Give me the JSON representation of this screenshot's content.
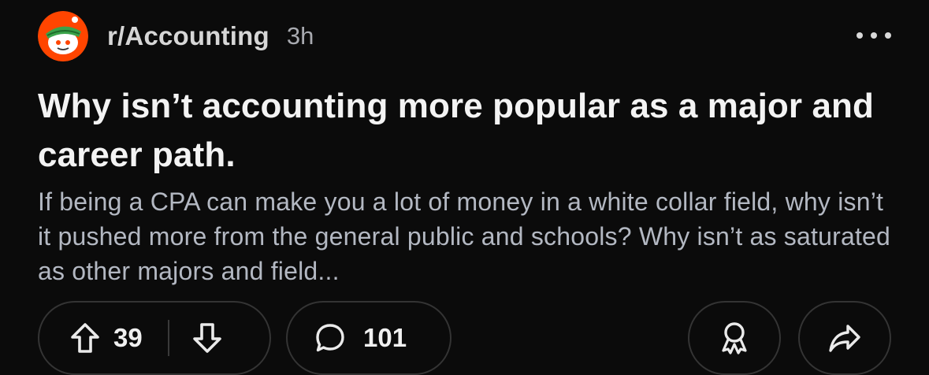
{
  "post": {
    "subreddit": "r/Accounting",
    "time_ago": "3h",
    "title": "Why isn’t accounting more popular as a major and career path.",
    "body": "If being a CPA can make you a lot of money in a white collar field, why isn’t it pushed more from the general public and schools? Why isn’t as saturated as other majors and field...",
    "score": "39",
    "comment_count": "101"
  },
  "icons": {
    "avatar": "subreddit-avatar",
    "more": "more-options-icon",
    "upvote": "upvote-arrow-icon",
    "downvote": "downvote-arrow-icon",
    "comment": "comment-bubble-icon",
    "award": "award-icon",
    "share": "share-arrow-icon"
  },
  "colors": {
    "background": "#0b0b0b",
    "avatar_bg": "#ff4500",
    "title_text": "#f3f3f3",
    "body_text": "#b3b8c2",
    "meta_text": "#a8aab0",
    "pill_border": "#343434"
  }
}
